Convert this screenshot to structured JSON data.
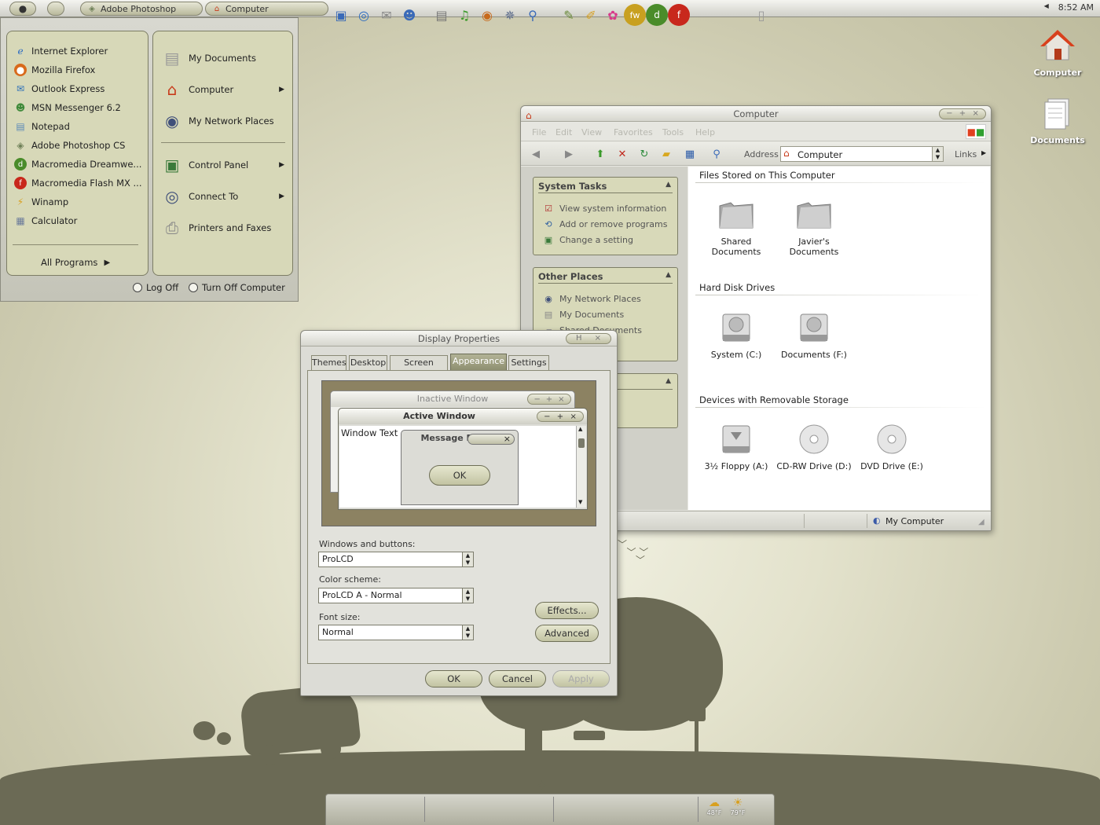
{
  "taskbar": {
    "buttons": [
      {
        "label": "Adobe Photoshop",
        "icon": "photoshop-icon"
      },
      {
        "label": "Computer",
        "icon": "computer-house-icon"
      }
    ],
    "clock": "8:52 AM"
  },
  "start_menu": {
    "programs": [
      {
        "label": "Internet Explorer",
        "icon": "internet-explorer-icon",
        "color": "#2a6bc2"
      },
      {
        "label": "Mozilla Firefox",
        "icon": "firefox-icon",
        "color": "#d86a1c"
      },
      {
        "label": "Outlook Express",
        "icon": "outlook-express-icon",
        "color": "#2c6fb8"
      },
      {
        "label": "MSN Messenger 6.2",
        "icon": "msn-messenger-icon",
        "color": "#3f8a3a"
      },
      {
        "label": "Notepad",
        "icon": "notepad-icon",
        "color": "#5c8ab8"
      },
      {
        "label": "Adobe Photoshop CS",
        "icon": "photoshop-icon",
        "color": "#6d7f56"
      },
      {
        "label": "Macromedia Dreamwe...",
        "icon": "dreamweaver-icon",
        "color": "#4a8c2a"
      },
      {
        "label": "Macromedia Flash MX ...",
        "icon": "flash-icon",
        "color": "#c8281c"
      },
      {
        "label": "Winamp",
        "icon": "winamp-icon",
        "color": "#d8a020"
      },
      {
        "label": "Calculator",
        "icon": "calculator-icon",
        "color": "#6a7a9a"
      }
    ],
    "all_programs": "All Programs",
    "places": [
      {
        "label": "My Documents",
        "icon": "documents-icon",
        "arrow": false
      },
      {
        "label": "Computer",
        "icon": "computer-house-icon",
        "arrow": true
      },
      {
        "label": "My Network Places",
        "icon": "network-globe-icon",
        "arrow": false
      },
      {
        "label": "Control Panel",
        "icon": "control-panel-icon",
        "arrow": true
      },
      {
        "label": "Connect To",
        "icon": "connect-globe-icon",
        "arrow": true
      },
      {
        "label": "Printers and Faxes",
        "icon": "printer-icon",
        "arrow": false
      }
    ],
    "log_off": "Log Off",
    "turn_off": "Turn Off Computer"
  },
  "desktop_icons": [
    {
      "label": "Computer",
      "icon": "computer-house-icon"
    },
    {
      "label": "Documents",
      "icon": "documents-icon"
    }
  ],
  "explorer": {
    "title": "Computer",
    "menu": [
      "File",
      "Edit",
      "View",
      "Favorites",
      "Tools",
      "Help"
    ],
    "address_label": "Address",
    "address_value": "Computer",
    "links_label": "Links",
    "system_tasks": {
      "title": "System Tasks",
      "items": [
        "View system information",
        "Add or remove programs",
        "Change a setting"
      ]
    },
    "other_places": {
      "title": "Other Places",
      "items": [
        "My Network Places",
        "My Documents",
        "Shared Documents"
      ]
    },
    "sections": [
      {
        "title": "Files Stored on This Computer",
        "items": [
          "Shared Documents",
          "Javier's Documents"
        ]
      },
      {
        "title": "Hard Disk Drives",
        "items": [
          "System (C:)",
          "Documents (F:)"
        ]
      },
      {
        "title": "Devices with Removable Storage",
        "items": [
          "3½ Floppy (A:)",
          "CD-RW Drive (D:)",
          "DVD Drive (E:)"
        ]
      }
    ],
    "status_text": "My Computer"
  },
  "display_properties": {
    "title": "Display Properties",
    "tabs": [
      "Themes",
      "Desktop",
      "Screen Saver",
      "Appearance",
      "Settings"
    ],
    "active_tab": "Appearance",
    "preview": {
      "inactive_title": "Inactive Window",
      "active_title": "Active Window",
      "window_text": "Window Text",
      "message_title": "Message Box",
      "ok": "OK"
    },
    "windows_buttons_label": "Windows and buttons:",
    "windows_buttons_value": "ProLCD",
    "color_scheme_label": "Color scheme:",
    "color_scheme_value": "ProLCD A - Normal",
    "font_size_label": "Font size:",
    "font_size_value": "Normal",
    "effects": "Effects...",
    "advanced": "Advanced",
    "ok": "OK",
    "cancel": "Cancel",
    "apply": "Apply"
  },
  "dock": {
    "weather": [
      "48°F",
      "79°F"
    ]
  },
  "colors": {
    "accent": "#8e8f70",
    "panel": "#d7d8b8",
    "silhouette": "#6b6a55"
  }
}
